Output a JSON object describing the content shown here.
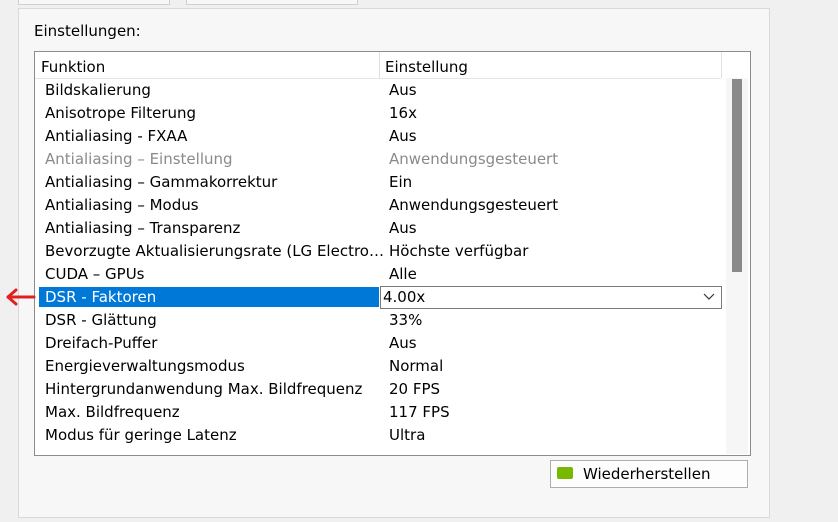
{
  "settings_label": "Einstellungen:",
  "columns": {
    "function": "Funktion",
    "setting": "Einstellung"
  },
  "rows": [
    {
      "function": "Bildskalierung",
      "setting": "Aus"
    },
    {
      "function": "Anisotrope Filterung",
      "setting": "16x"
    },
    {
      "function": "Antialiasing - FXAA",
      "setting": "Aus"
    },
    {
      "function": "Antialiasing – Einstellung",
      "setting": "Anwendungsgesteuert"
    },
    {
      "function": "Antialiasing – Gammakorrektur",
      "setting": "Ein"
    },
    {
      "function": "Antialiasing – Modus",
      "setting": "Anwendungsgesteuert"
    },
    {
      "function": "Antialiasing – Transparenz",
      "setting": "Aus"
    },
    {
      "function": "Bevorzugte Aktualisierungsrate (LG Electro…",
      "setting": "Höchste verfügbar"
    },
    {
      "function": "CUDA – GPUs",
      "setting": "Alle"
    },
    {
      "function": "DSR - Faktoren",
      "setting": "4.00x"
    },
    {
      "function": "DSR - Glättung",
      "setting": "33%"
    },
    {
      "function": "Dreifach-Puffer",
      "setting": "Aus"
    },
    {
      "function": "Energieverwaltungsmodus",
      "setting": "Normal"
    },
    {
      "function": "Hintergrundanwendung Max. Bildfrequenz",
      "setting": "20 FPS"
    },
    {
      "function": "Max. Bildfrequenz",
      "setting": "117 FPS"
    },
    {
      "function": "Modus für geringe Latenz",
      "setting": "Ultra"
    }
  ],
  "restore_button": "Wiederherstellen",
  "colors": {
    "selection": "#0078d7",
    "arrow": "#e32020",
    "nvidia": "#76b900"
  }
}
